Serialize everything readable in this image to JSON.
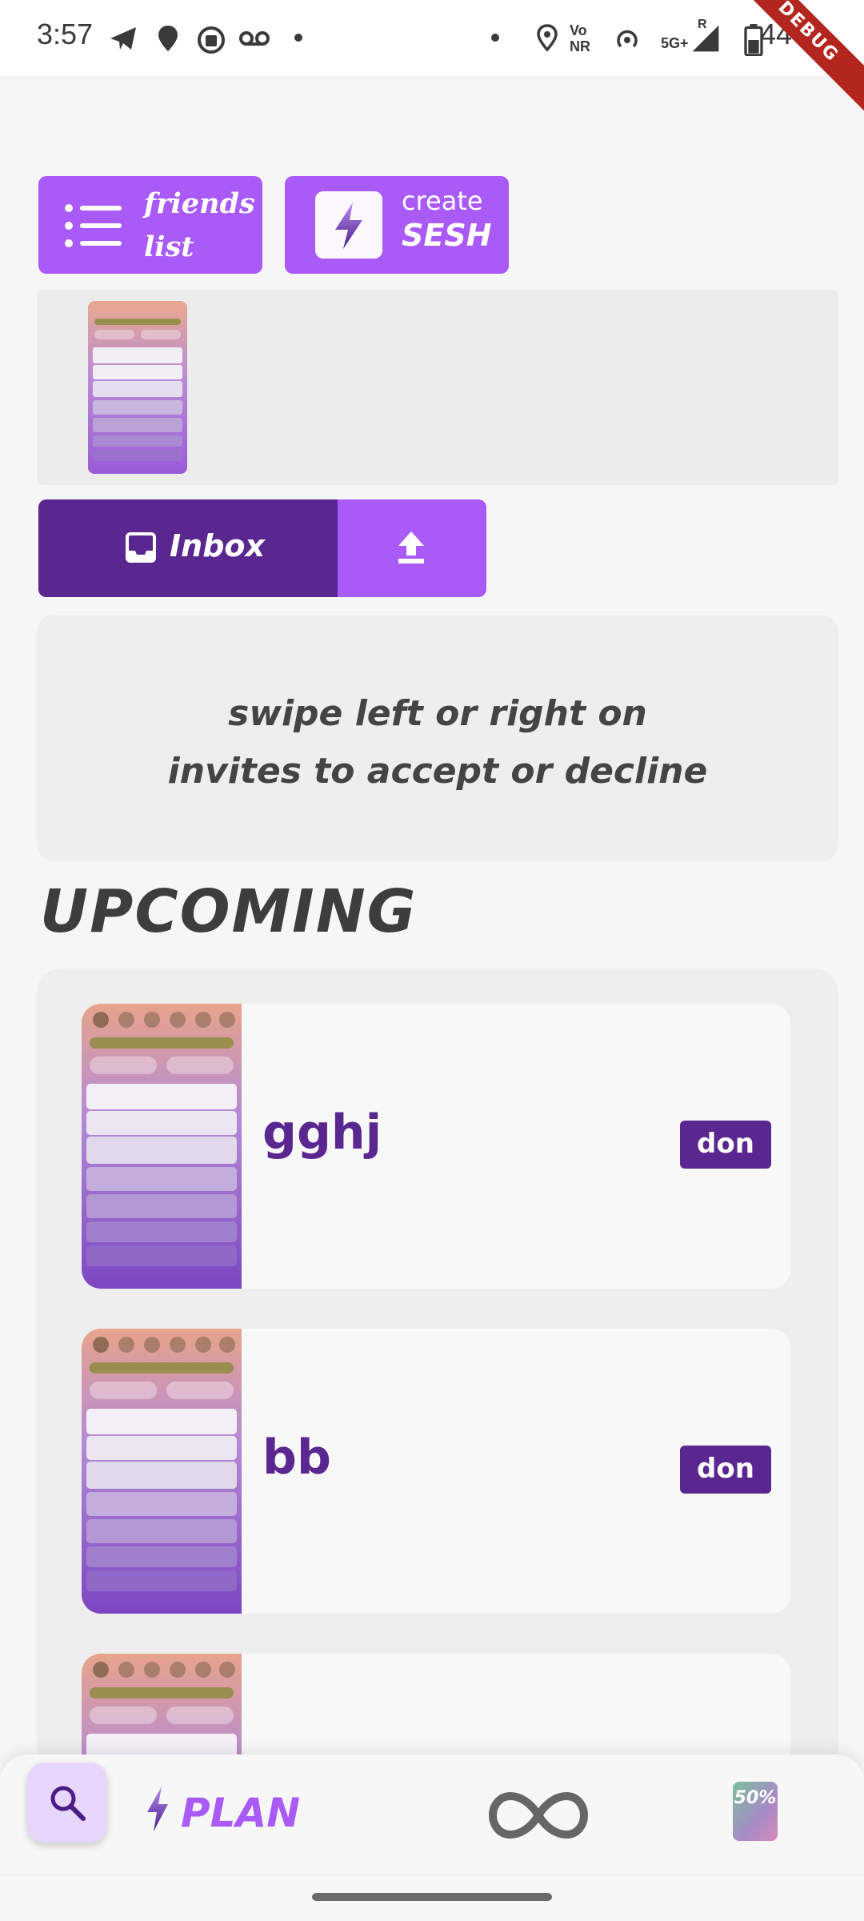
{
  "status_bar": {
    "time": "3:57",
    "network_label_top": "Vo",
    "network_label_bottom": "NR",
    "signal_label": "5G+",
    "roaming": "R",
    "battery": "44",
    "debug_banner": "DEBUG"
  },
  "top_buttons": {
    "friends_line1": "friends",
    "friends_line2": "list",
    "create_label": "create",
    "sesh_label": "SESH"
  },
  "segmented": {
    "inbox_label": "Inbox"
  },
  "info_card": {
    "line1": "swipe left or right on",
    "line2": "invites to accept or decline"
  },
  "upcoming": {
    "heading": "UPCOMING",
    "cards": [
      {
        "title": "gghj",
        "badge": "don"
      },
      {
        "title": "bb",
        "badge": "don"
      },
      {
        "title": "",
        "badge": ""
      }
    ]
  },
  "bottom_nav": {
    "plan_label": "PLAN",
    "promo_text": "50%"
  },
  "colors": {
    "accent": "#a95af7",
    "dark_purple": "#5a2790",
    "background": "#f6f6f6",
    "card_bg": "#eeeeee"
  },
  "icons": [
    "telegram-icon",
    "location-icon",
    "bag-icon",
    "voicemail-icon",
    "hotspot-icon",
    "battery-icon",
    "list-icon",
    "bolt-icon",
    "inbox-icon",
    "upload-icon",
    "search-icon",
    "infinity-icon"
  ]
}
